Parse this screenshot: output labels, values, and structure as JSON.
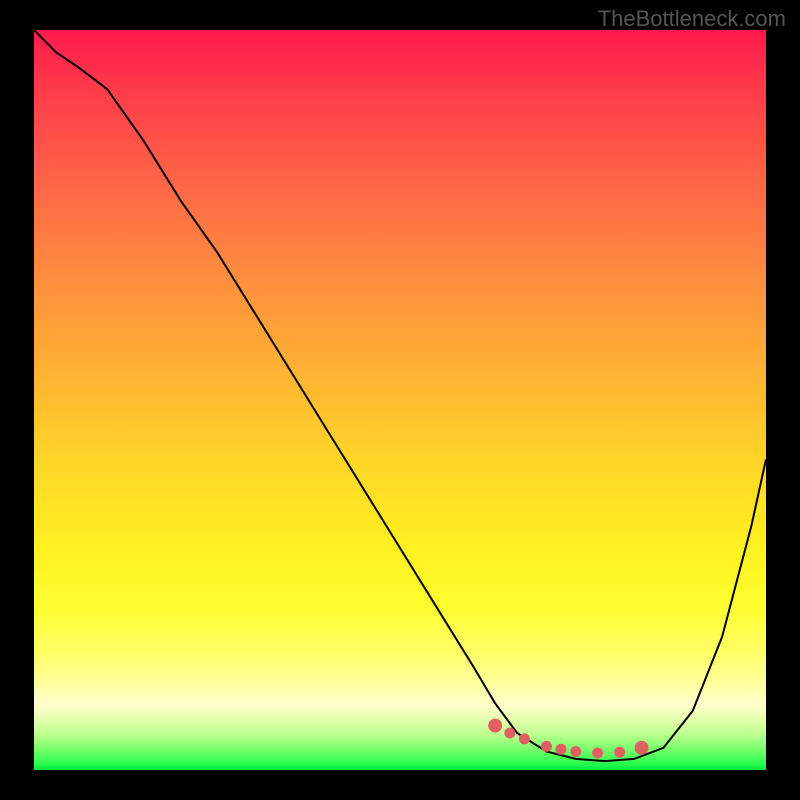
{
  "watermark": "TheBottleneck.com",
  "chart_data": {
    "type": "line",
    "title": "",
    "xlabel": "",
    "ylabel": "",
    "xlim": [
      0,
      100
    ],
    "ylim": [
      0,
      100
    ],
    "background": "rainbow-gradient-red-to-green",
    "series": [
      {
        "name": "curve",
        "x": [
          0,
          3,
          6,
          10,
          15,
          20,
          25,
          30,
          35,
          40,
          45,
          50,
          55,
          60,
          63,
          66,
          70,
          74,
          78,
          82,
          86,
          90,
          94,
          98,
          100
        ],
        "values": [
          100,
          97,
          95,
          92,
          85,
          77,
          70,
          62,
          54,
          46,
          38,
          30,
          22,
          14,
          9,
          5,
          2.5,
          1.5,
          1.2,
          1.5,
          3,
          8,
          18,
          33,
          42
        ]
      }
    ],
    "highlight_points": {
      "name": "optimal-region",
      "color": "#e06060",
      "x": [
        63,
        65,
        67,
        70,
        72,
        74,
        77,
        80,
        83
      ],
      "values": [
        6,
        5,
        4.2,
        3.2,
        2.8,
        2.5,
        2.3,
        2.4,
        3
      ]
    }
  }
}
